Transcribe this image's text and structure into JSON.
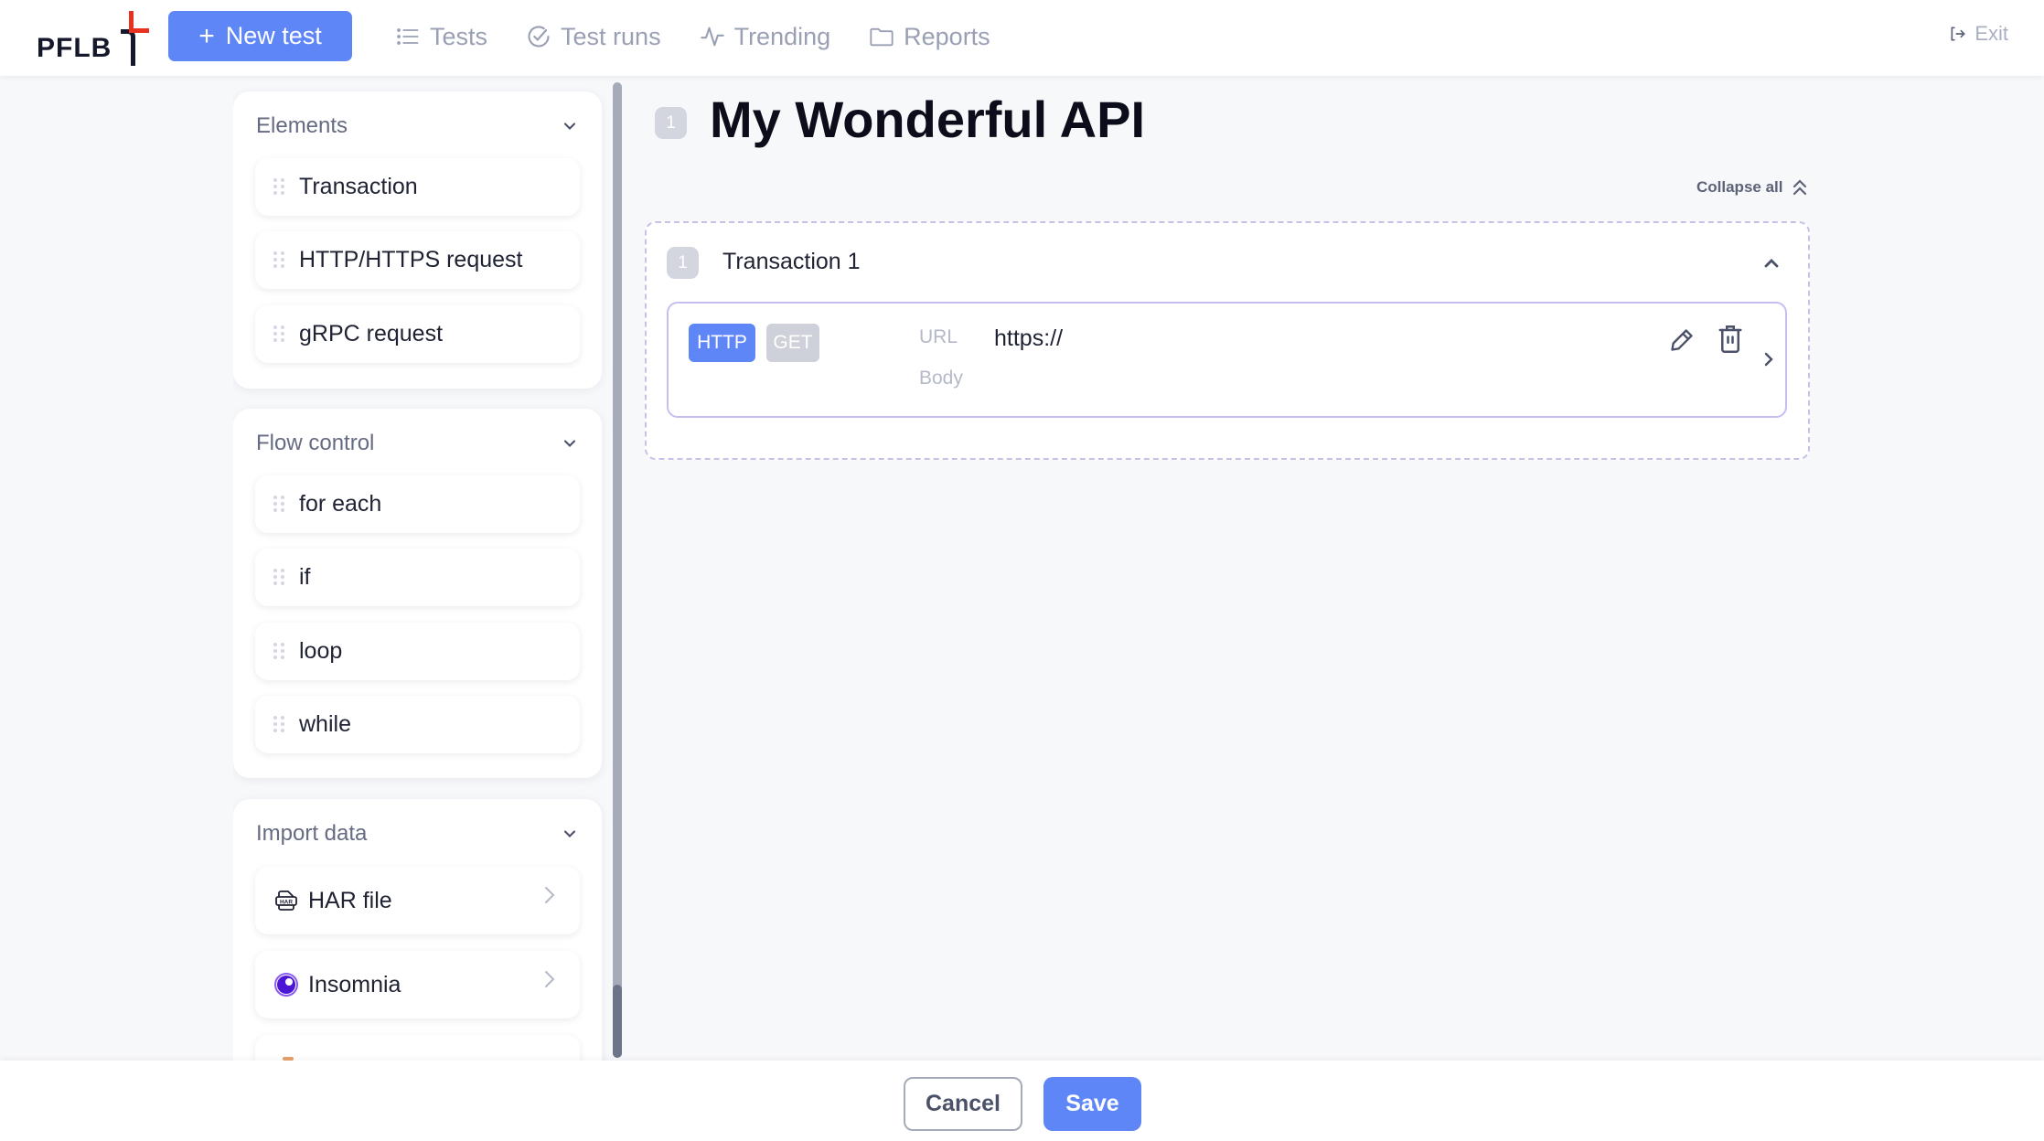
{
  "header": {
    "logo": "PFLB",
    "new_test_label": "New test",
    "nav": [
      {
        "label": "Tests",
        "icon": "list-icon"
      },
      {
        "label": "Test runs",
        "icon": "check-circle-icon"
      },
      {
        "label": "Trending",
        "icon": "pulse-icon"
      },
      {
        "label": "Reports",
        "icon": "folder-icon"
      }
    ],
    "exit_label": "Exit"
  },
  "sidebar": {
    "sections": [
      {
        "title": "Elements",
        "items": [
          "Transaction",
          "HTTP/HTTPS request",
          "gRPC request"
        ]
      },
      {
        "title": "Flow control",
        "items": [
          "for each",
          "if",
          "loop",
          "while"
        ]
      },
      {
        "title": "Import data",
        "items": [
          {
            "label": "HAR file",
            "icon": "har-file-icon"
          },
          {
            "label": "Insomnia",
            "icon": "insomnia-icon"
          }
        ]
      }
    ]
  },
  "main": {
    "title_index": "1",
    "title": "My Wonderful API",
    "collapse_all_label": "Collapse all",
    "transaction": {
      "index": "1",
      "title": "Transaction 1",
      "request": {
        "protocol": "HTTP",
        "method": "GET",
        "url_label": "URL",
        "url_value": "https://",
        "body_label": "Body"
      }
    }
  },
  "footer": {
    "cancel_label": "Cancel",
    "save_label": "Save"
  },
  "colors": {
    "accent": "#5f86f7",
    "logo_red": "#e8311f",
    "insomnia_purple": "#4b16d6"
  }
}
